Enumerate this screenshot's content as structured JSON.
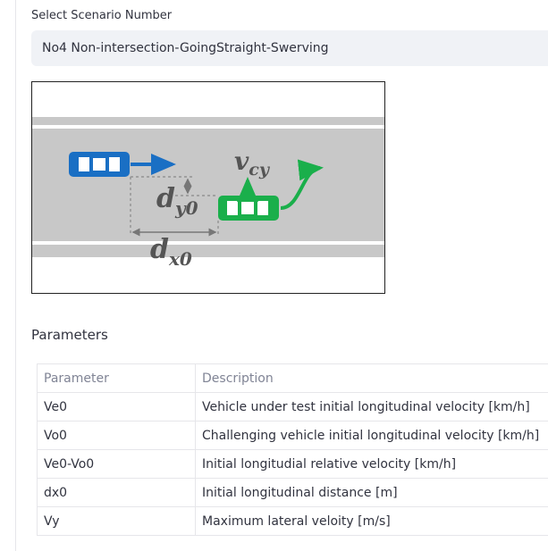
{
  "select": {
    "label": "Select Scenario Number",
    "value": "No4 Non-intersection-GoingStraight-Swerving"
  },
  "figure": {
    "labels": {
      "vcy": "v",
      "vcy_sub": "cy",
      "dy0": "d",
      "dy0_sub": "y0",
      "dx0": "d",
      "dx0_sub": "x0"
    },
    "colors": {
      "road": "#c8c8c8",
      "lane_line": "#ffffff",
      "blue_car": "#1a6fc4",
      "green_car": "#1aaf4b",
      "label": "#555555"
    }
  },
  "parameters": {
    "heading": "Parameters",
    "columns": [
      "Parameter",
      "Description"
    ],
    "rows": [
      {
        "param": "Ve0",
        "desc": "Vehicle under test initial longitudinal velocity [km/h]"
      },
      {
        "param": "Vo0",
        "desc": "Challenging vehicle initial longitudinal velocity [km/h]"
      },
      {
        "param": "Ve0-Vo0",
        "desc": "Initial longitudial relative velocity [km/h]"
      },
      {
        "param": "dx0",
        "desc": "Initial longitudinal distance [m]"
      },
      {
        "param": "Vy",
        "desc": "Maximum lateral veloity [m/s]"
      }
    ]
  }
}
